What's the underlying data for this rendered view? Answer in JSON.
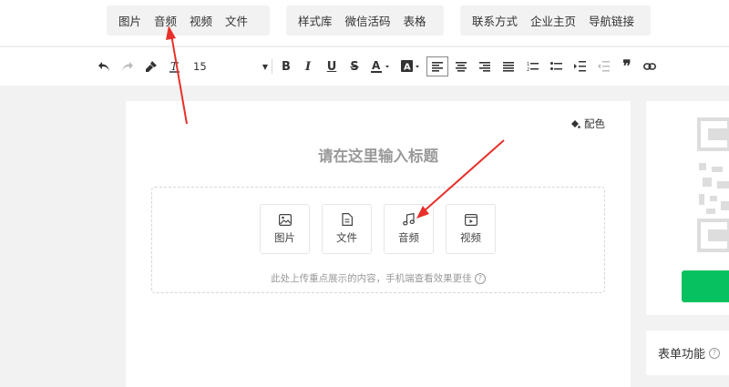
{
  "top_menu": {
    "group1": [
      "图片",
      "音频",
      "视频",
      "文件"
    ],
    "group2": [
      "样式库",
      "微信活码",
      "表格"
    ],
    "group3": [
      "联系方式",
      "企业主页",
      "导航链接"
    ]
  },
  "toolbar": {
    "font_size": "15"
  },
  "editor": {
    "palette_label": "配色",
    "title_placeholder": "请在这里输入标题",
    "upload_buttons": [
      "图片",
      "文件",
      "音频",
      "视频"
    ],
    "upload_hint": "此处上传重点展示的内容，手机端查看效果更佳"
  },
  "right_panel": {
    "form_title": "表单功能"
  },
  "colors": {
    "accent_green": "#07c160",
    "annotation_red": "#e8302a"
  }
}
